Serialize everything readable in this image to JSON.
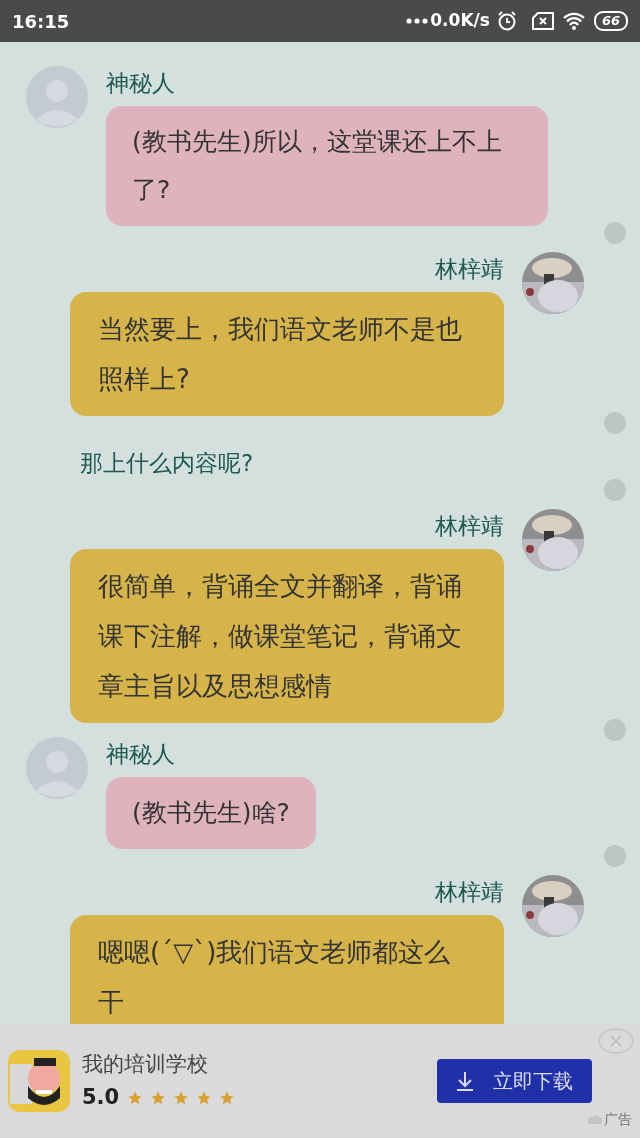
{
  "status_bar": {
    "time": "16:15",
    "network_speed": "0.0K/s",
    "battery": "66"
  },
  "messages": [
    {
      "kind": "left",
      "name": "神秘人",
      "text": "(教书先生)所以，这堂课还上不上了?"
    },
    {
      "kind": "right",
      "name": "林梓靖",
      "text": "当然要上，我们语文老师不是也照样上?"
    },
    {
      "kind": "narration",
      "text": "那上什么内容呢?"
    },
    {
      "kind": "right",
      "name": "林梓靖",
      "text": "很简单，背诵全文并翻译，背诵课下注解，做课堂笔记，背诵文章主旨以及思想感情"
    },
    {
      "kind": "left",
      "name": "神秘人",
      "text": "(教书先生)啥?"
    },
    {
      "kind": "right",
      "name": "林梓靖",
      "text": "嗯嗯(´▽`)我们语文老师都这么干"
    }
  ],
  "ad": {
    "title": "我的培训学校",
    "rating": "5.0",
    "stars": 5,
    "button": "立即下载",
    "label": "广告"
  }
}
